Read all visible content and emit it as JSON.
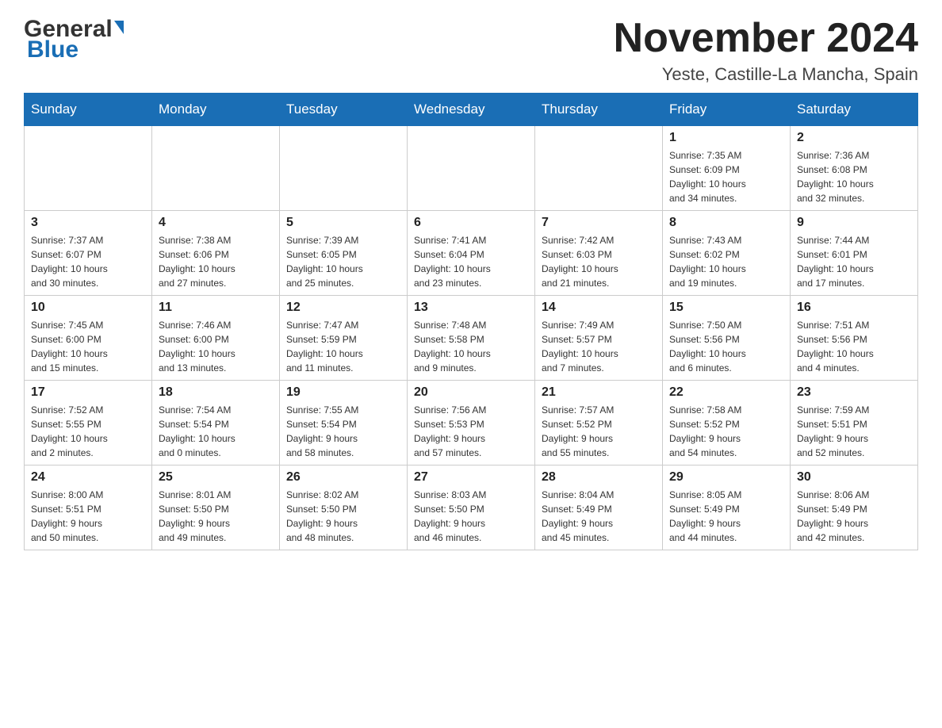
{
  "header": {
    "logo_general": "General",
    "logo_blue": "Blue",
    "main_title": "November 2024",
    "subtitle": "Yeste, Castille-La Mancha, Spain"
  },
  "days_of_week": [
    "Sunday",
    "Monday",
    "Tuesday",
    "Wednesday",
    "Thursday",
    "Friday",
    "Saturday"
  ],
  "weeks": [
    [
      {
        "day": "",
        "info": ""
      },
      {
        "day": "",
        "info": ""
      },
      {
        "day": "",
        "info": ""
      },
      {
        "day": "",
        "info": ""
      },
      {
        "day": "",
        "info": ""
      },
      {
        "day": "1",
        "info": "Sunrise: 7:35 AM\nSunset: 6:09 PM\nDaylight: 10 hours\nand 34 minutes."
      },
      {
        "day": "2",
        "info": "Sunrise: 7:36 AM\nSunset: 6:08 PM\nDaylight: 10 hours\nand 32 minutes."
      }
    ],
    [
      {
        "day": "3",
        "info": "Sunrise: 7:37 AM\nSunset: 6:07 PM\nDaylight: 10 hours\nand 30 minutes."
      },
      {
        "day": "4",
        "info": "Sunrise: 7:38 AM\nSunset: 6:06 PM\nDaylight: 10 hours\nand 27 minutes."
      },
      {
        "day": "5",
        "info": "Sunrise: 7:39 AM\nSunset: 6:05 PM\nDaylight: 10 hours\nand 25 minutes."
      },
      {
        "day": "6",
        "info": "Sunrise: 7:41 AM\nSunset: 6:04 PM\nDaylight: 10 hours\nand 23 minutes."
      },
      {
        "day": "7",
        "info": "Sunrise: 7:42 AM\nSunset: 6:03 PM\nDaylight: 10 hours\nand 21 minutes."
      },
      {
        "day": "8",
        "info": "Sunrise: 7:43 AM\nSunset: 6:02 PM\nDaylight: 10 hours\nand 19 minutes."
      },
      {
        "day": "9",
        "info": "Sunrise: 7:44 AM\nSunset: 6:01 PM\nDaylight: 10 hours\nand 17 minutes."
      }
    ],
    [
      {
        "day": "10",
        "info": "Sunrise: 7:45 AM\nSunset: 6:00 PM\nDaylight: 10 hours\nand 15 minutes."
      },
      {
        "day": "11",
        "info": "Sunrise: 7:46 AM\nSunset: 6:00 PM\nDaylight: 10 hours\nand 13 minutes."
      },
      {
        "day": "12",
        "info": "Sunrise: 7:47 AM\nSunset: 5:59 PM\nDaylight: 10 hours\nand 11 minutes."
      },
      {
        "day": "13",
        "info": "Sunrise: 7:48 AM\nSunset: 5:58 PM\nDaylight: 10 hours\nand 9 minutes."
      },
      {
        "day": "14",
        "info": "Sunrise: 7:49 AM\nSunset: 5:57 PM\nDaylight: 10 hours\nand 7 minutes."
      },
      {
        "day": "15",
        "info": "Sunrise: 7:50 AM\nSunset: 5:56 PM\nDaylight: 10 hours\nand 6 minutes."
      },
      {
        "day": "16",
        "info": "Sunrise: 7:51 AM\nSunset: 5:56 PM\nDaylight: 10 hours\nand 4 minutes."
      }
    ],
    [
      {
        "day": "17",
        "info": "Sunrise: 7:52 AM\nSunset: 5:55 PM\nDaylight: 10 hours\nand 2 minutes."
      },
      {
        "day": "18",
        "info": "Sunrise: 7:54 AM\nSunset: 5:54 PM\nDaylight: 10 hours\nand 0 minutes."
      },
      {
        "day": "19",
        "info": "Sunrise: 7:55 AM\nSunset: 5:54 PM\nDaylight: 9 hours\nand 58 minutes."
      },
      {
        "day": "20",
        "info": "Sunrise: 7:56 AM\nSunset: 5:53 PM\nDaylight: 9 hours\nand 57 minutes."
      },
      {
        "day": "21",
        "info": "Sunrise: 7:57 AM\nSunset: 5:52 PM\nDaylight: 9 hours\nand 55 minutes."
      },
      {
        "day": "22",
        "info": "Sunrise: 7:58 AM\nSunset: 5:52 PM\nDaylight: 9 hours\nand 54 minutes."
      },
      {
        "day": "23",
        "info": "Sunrise: 7:59 AM\nSunset: 5:51 PM\nDaylight: 9 hours\nand 52 minutes."
      }
    ],
    [
      {
        "day": "24",
        "info": "Sunrise: 8:00 AM\nSunset: 5:51 PM\nDaylight: 9 hours\nand 50 minutes."
      },
      {
        "day": "25",
        "info": "Sunrise: 8:01 AM\nSunset: 5:50 PM\nDaylight: 9 hours\nand 49 minutes."
      },
      {
        "day": "26",
        "info": "Sunrise: 8:02 AM\nSunset: 5:50 PM\nDaylight: 9 hours\nand 48 minutes."
      },
      {
        "day": "27",
        "info": "Sunrise: 8:03 AM\nSunset: 5:50 PM\nDaylight: 9 hours\nand 46 minutes."
      },
      {
        "day": "28",
        "info": "Sunrise: 8:04 AM\nSunset: 5:49 PM\nDaylight: 9 hours\nand 45 minutes."
      },
      {
        "day": "29",
        "info": "Sunrise: 8:05 AM\nSunset: 5:49 PM\nDaylight: 9 hours\nand 44 minutes."
      },
      {
        "day": "30",
        "info": "Sunrise: 8:06 AM\nSunset: 5:49 PM\nDaylight: 9 hours\nand 42 minutes."
      }
    ]
  ]
}
